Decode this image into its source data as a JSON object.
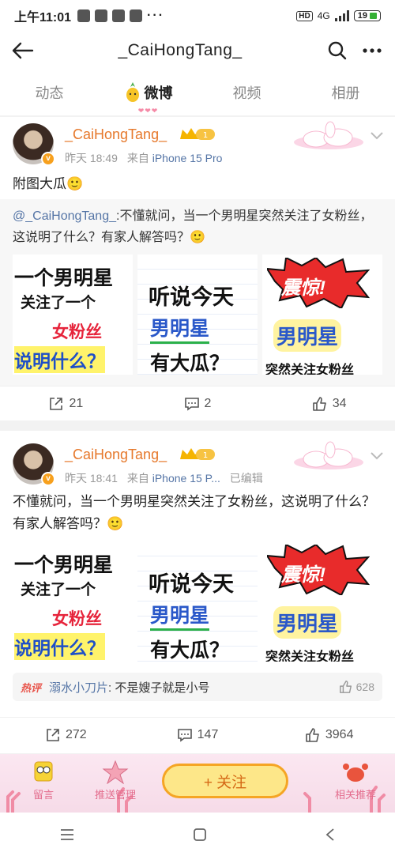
{
  "status_bar": {
    "time": "上午11:01",
    "network": "4G",
    "battery": "19"
  },
  "header": {
    "title": "_CaiHongTang_"
  },
  "tabs": [
    {
      "label": "动态"
    },
    {
      "label": "微博",
      "active": true
    },
    {
      "label": "视频"
    },
    {
      "label": "相册"
    }
  ],
  "posts": [
    {
      "username": "_CaiHongTang_",
      "time": "昨天 18:49",
      "source_prefix": "来自 ",
      "source": "iPhone 15 Pro",
      "text": "附图大瓜🙂",
      "repost": {
        "mention": "@_CaiHongTang_",
        "text": ":不懂就问，当一个男明星突然关注了女粉丝，这说明了什么？有家人解答吗？🙂",
        "images": [
          {
            "lines": [
              "一个男明星",
              "关注了一个",
              "女粉丝",
              "说明什么？"
            ]
          },
          {
            "lines": [
              "听说今天",
              "男明星",
              "有大瓜？"
            ]
          },
          {
            "lines": [
              "震惊!",
              "男明星",
              "突然关注女粉丝"
            ]
          }
        ]
      },
      "actions": {
        "reposts": "21",
        "comments": "2",
        "likes": "34"
      }
    },
    {
      "username": "_CaiHongTang_",
      "time": "昨天 18:41",
      "source_prefix": "来自 ",
      "source": "iPhone 15 P...",
      "edited": "已编辑",
      "text": "不懂就问，当一个男明星突然关注了女粉丝，这说明了什么？有家人解答吗？🙂",
      "images": [
        {
          "lines": [
            "一个男明星",
            "关注了一个",
            "女粉丝",
            "说明什么？"
          ]
        },
        {
          "lines": [
            "听说今天",
            "男明星",
            "有大瓜？"
          ]
        },
        {
          "lines": [
            "震惊!",
            "男明星",
            "突然关注女粉丝"
          ]
        }
      ],
      "hot_comment": {
        "tag": "热评",
        "author": "溺水小刀片",
        "text": ": 不是嫂子就是小号",
        "likes": "628"
      },
      "actions": {
        "reposts": "272",
        "comments": "147",
        "likes": "3964"
      }
    }
  ],
  "bottom_bar": {
    "left_label": "留言",
    "mid_label": "推送管理",
    "follow_label": "+ 关注",
    "right_label": "相关推荐"
  },
  "colors": {
    "username": "#e6782b",
    "link": "#5575a6",
    "hot_tag": "#e8544a",
    "follow_border": "#f5a524"
  }
}
